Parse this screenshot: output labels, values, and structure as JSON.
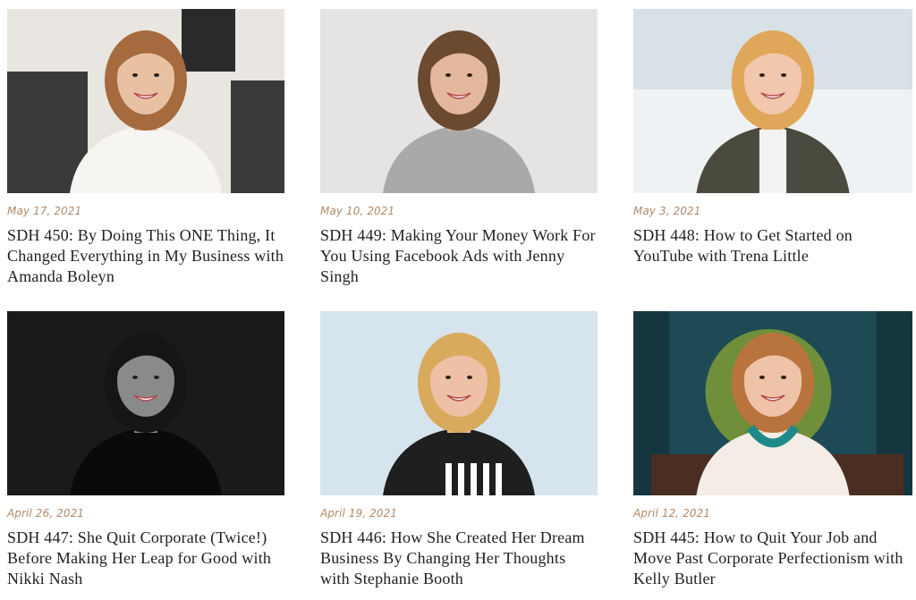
{
  "posts": [
    {
      "date": "May 17, 2021",
      "title": "SDH 450: By Doing This ONE Thing, It Changed Everything in My Business with Amanda Boleyn",
      "image_alt": "Amanda Boleyn portrait",
      "colors": {
        "bg": "#e9e6e1",
        "accent": "#3a3a3a",
        "shirt": "#f7f5f2",
        "hair": "#a56a3e",
        "skin": "#e8c1a3"
      }
    },
    {
      "date": "May 10, 2021",
      "title": "SDH 449: Making Your Money Work For You Using Facebook Ads with Jenny Singh",
      "image_alt": "Jenny Singh portrait",
      "colors": {
        "bg": "#e6e3e3",
        "accent": "#e6e3e3",
        "shirt": "#a9a9a9",
        "hair": "#6b4a30",
        "skin": "#e2b79b"
      }
    },
    {
      "date": "May 3, 2021",
      "title": "SDH 448: How to Get Started on YouTube with Trena Little",
      "image_alt": "Trena Little portrait",
      "colors": {
        "bg": "#eef2f4",
        "accent": "#c9d6dc",
        "shirt": "#4a4a3f",
        "hair": "#e0a75a",
        "skin": "#f1c7ae"
      }
    },
    {
      "date": "April 26, 2021",
      "title": "SDH 447: She Quit Corporate (Twice!) Before Making Her Leap for Good with Nikki Nash",
      "image_alt": "Nikki Nash portrait",
      "colors": {
        "bg": "#111111",
        "accent": "#1c1c1c",
        "shirt": "#0a0a0a",
        "hair": "#151515",
        "skin": "#8a8a8a"
      }
    },
    {
      "date": "April 19, 2021",
      "title": "SDH 446: How She Created Her Dream Business By Changing Her Thoughts with Stephanie Booth",
      "image_alt": "Stephanie Booth portrait",
      "colors": {
        "bg": "#dfeaf2",
        "accent": "#c7dbe8",
        "shirt": "#1f1f1f",
        "hair": "#d9a95c",
        "skin": "#eec0a5"
      }
    },
    {
      "date": "April 12, 2021",
      "title": "SDH 445: How to Quit Your Job and Move Past Corporate Perfectionism with Kelly Butler",
      "image_alt": "Kelly Butler portrait",
      "colors": {
        "bg": "#1e4a55",
        "accent": "#6f8f3a",
        "shirt": "#f3ede6",
        "hair": "#b8743c",
        "skin": "#efc3a7"
      }
    }
  ]
}
